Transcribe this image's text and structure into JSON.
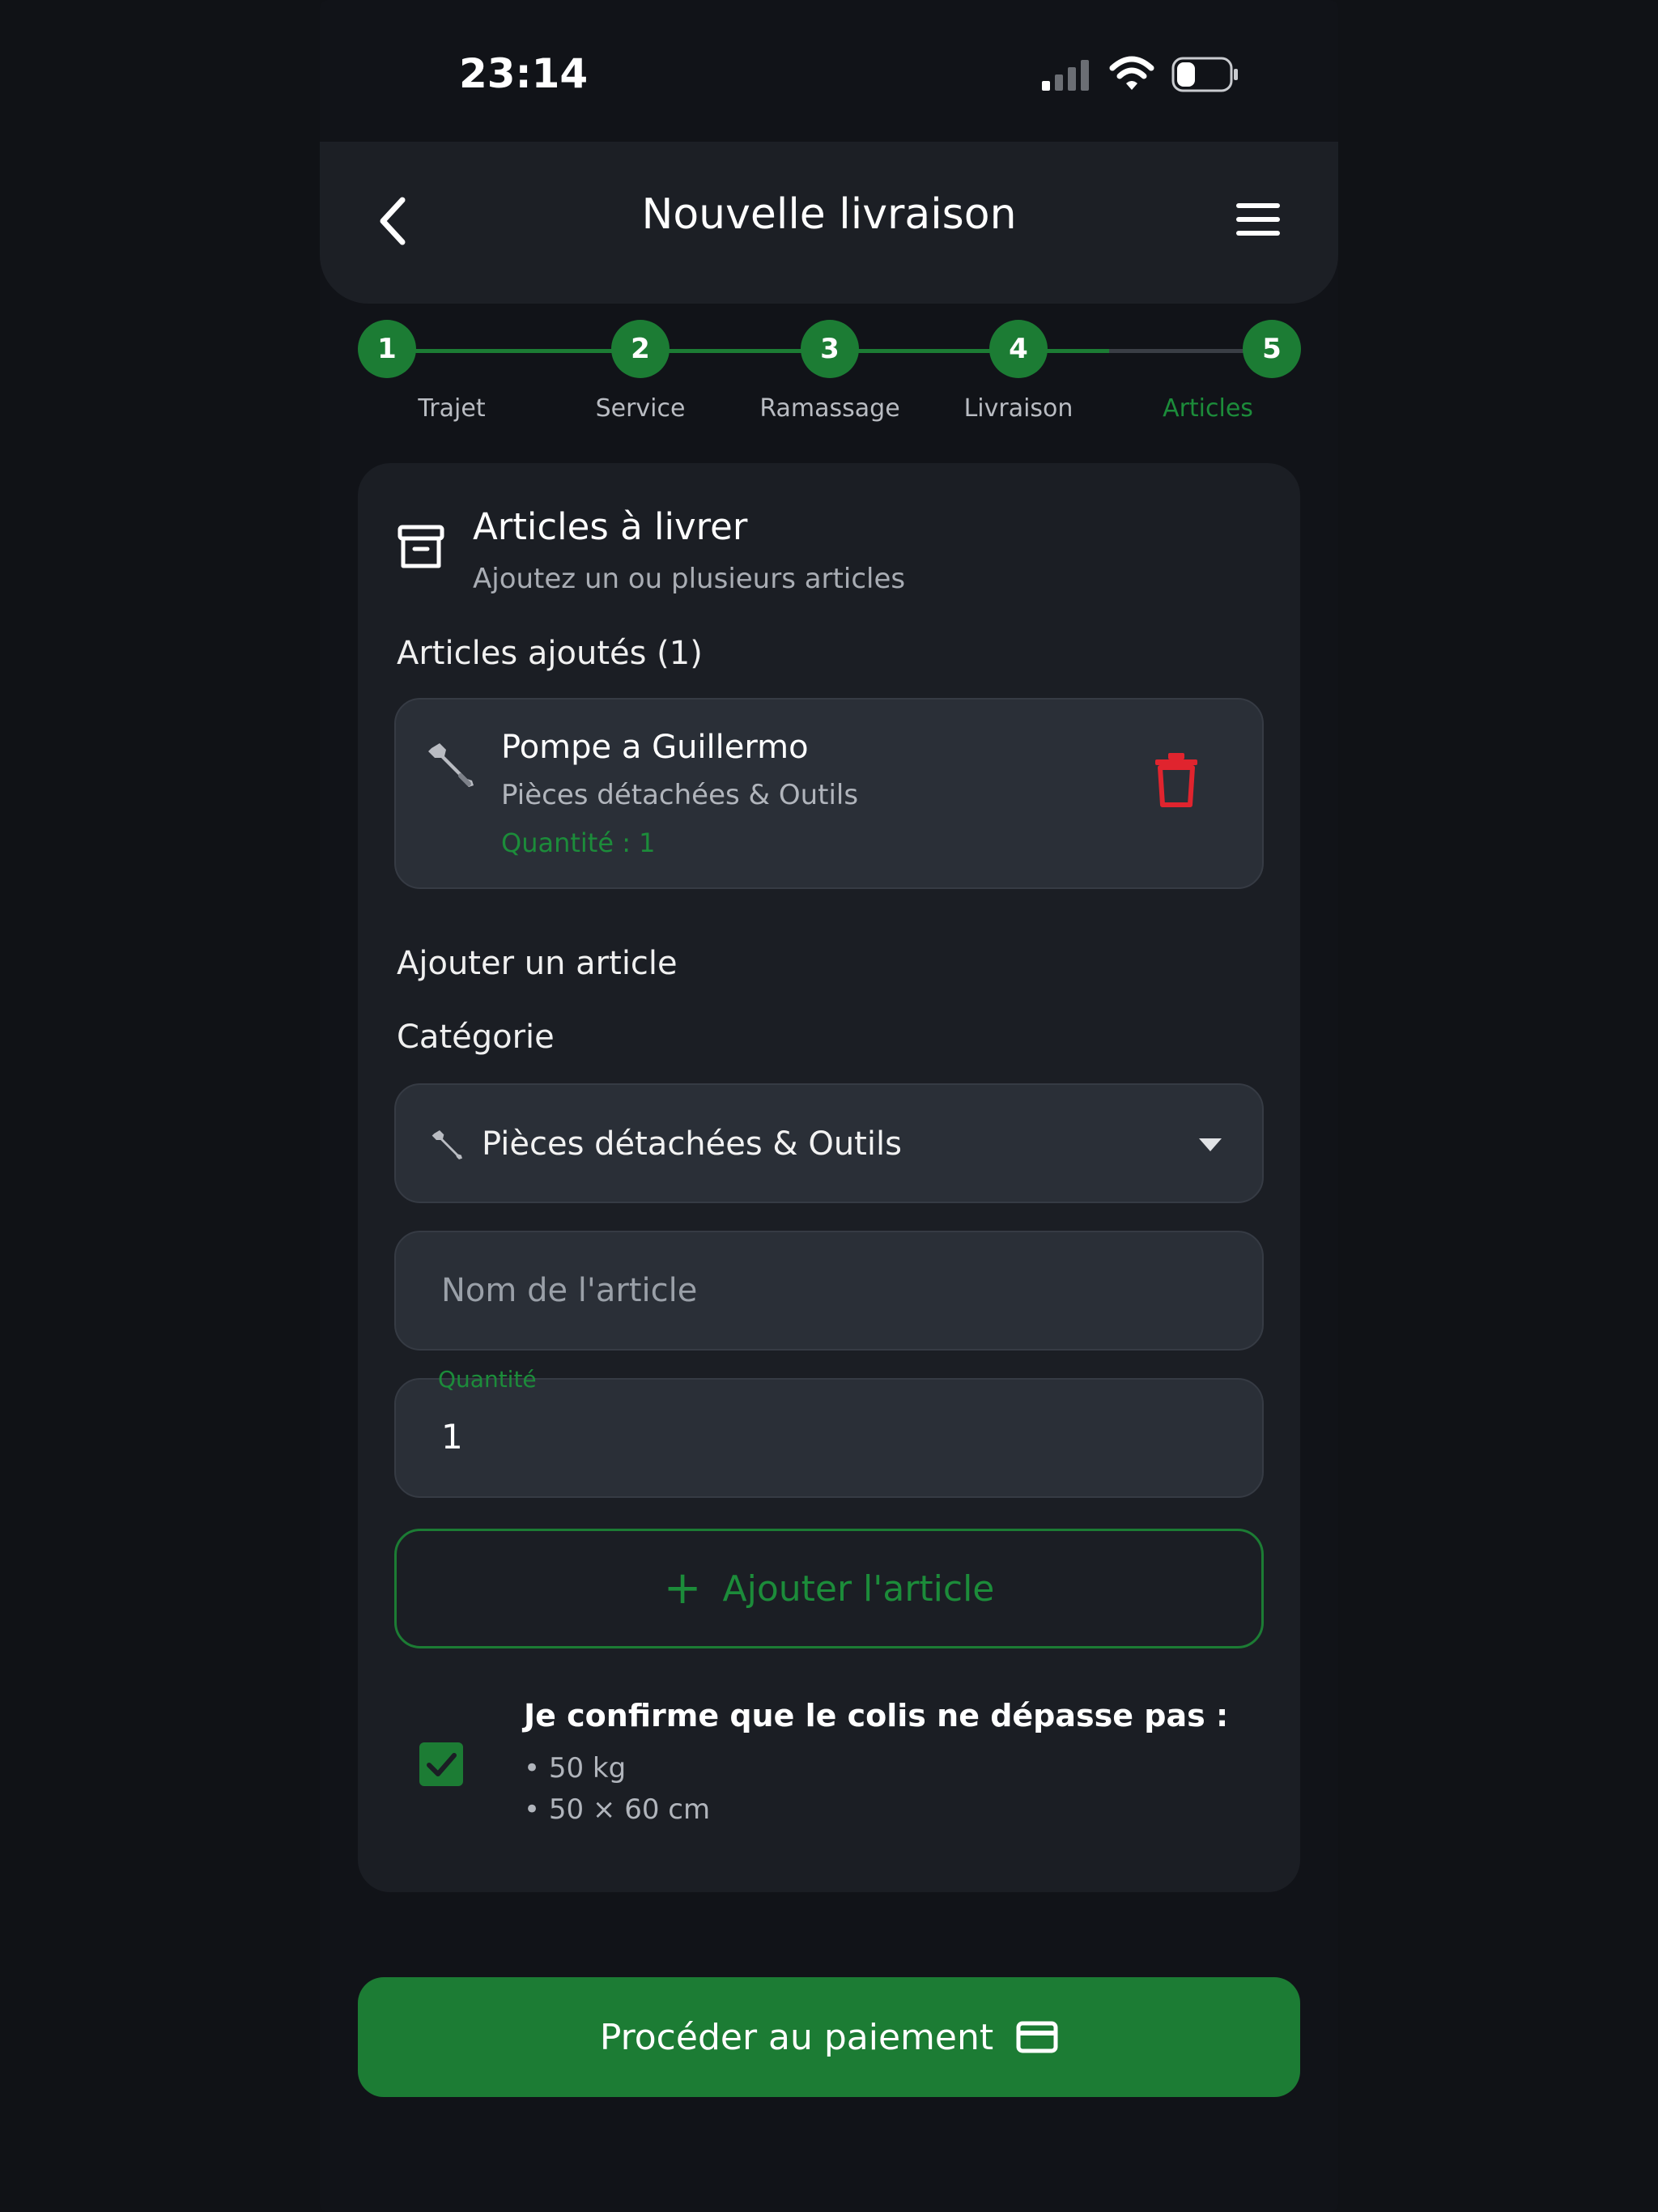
{
  "status": {
    "time": "23:14"
  },
  "header": {
    "title": "Nouvelle livraison"
  },
  "stepper": {
    "steps": [
      {
        "number": "1",
        "label": "Trajet"
      },
      {
        "number": "2",
        "label": "Service"
      },
      {
        "number": "3",
        "label": "Ramassage"
      },
      {
        "number": "4",
        "label": "Livraison"
      },
      {
        "number": "5",
        "label": "Articles"
      }
    ],
    "active_step": 5
  },
  "card": {
    "title": "Articles à livrer",
    "subtitle": "Ajoutez un ou plusieurs articles",
    "added_heading": "Articles ajoutés (1)",
    "item": {
      "name": "Pompe a Guillermo",
      "category": "Pièces détachées & Outils",
      "quantity": "Quantité : 1",
      "icon": "wrench-icon"
    },
    "add_heading": "Ajouter un article",
    "category_label": "Catégorie",
    "category_select": {
      "value": "Pièces détachées & Outils",
      "icon": "wrench-icon"
    },
    "name_input": {
      "placeholder": "Nom de l'article",
      "value": ""
    },
    "quantity_input": {
      "label": "Quantité",
      "value": "1"
    },
    "add_button": {
      "label": "Ajouter l'article"
    },
    "confirm": {
      "checked": true,
      "text": "Je confirme que le colis ne dépasse pas :",
      "line1": "• 50 kg",
      "line2": "• 50 × 60 cm"
    }
  },
  "pay_button": {
    "label": "Procéder au paiement",
    "icon": "credit-card-icon"
  },
  "colors": {
    "accent": "#1c7c34",
    "accent_text": "#1c8c3a",
    "danger": "#e0242e",
    "background": "#111318",
    "card": "#1b1e24",
    "field": "#2a2f37"
  }
}
